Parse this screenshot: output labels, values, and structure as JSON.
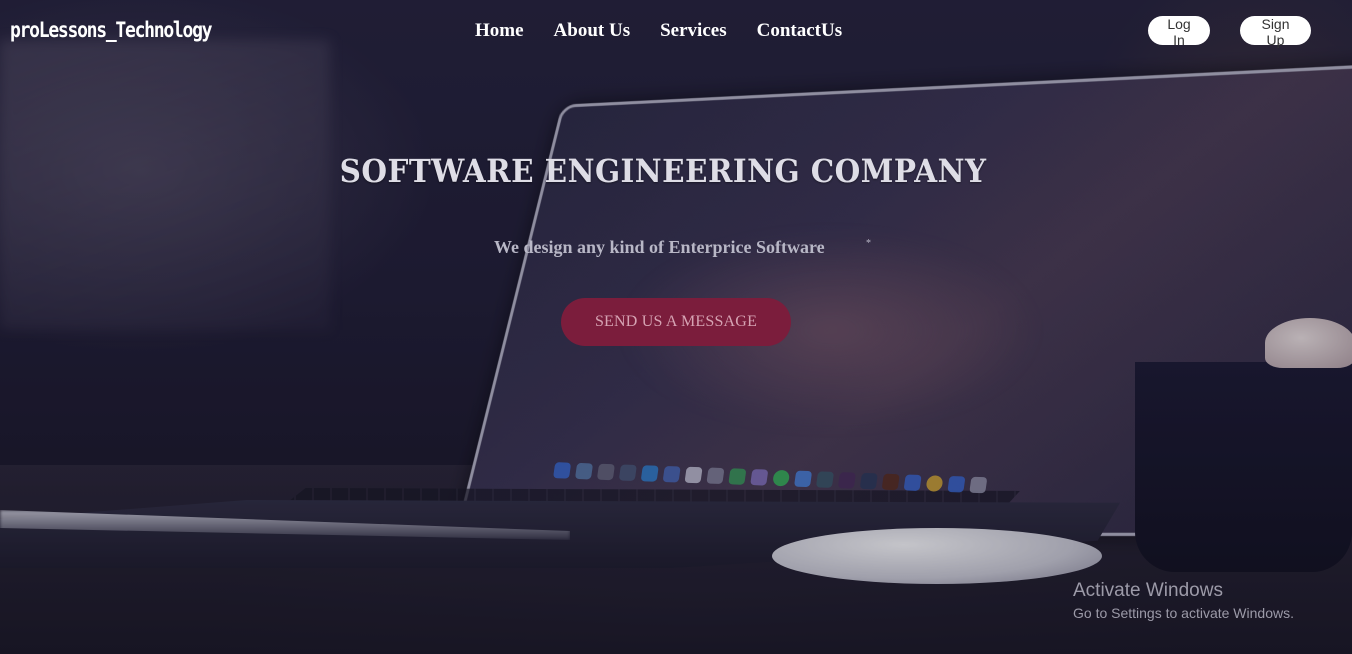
{
  "header": {
    "brand": "proLessons_Technology",
    "nav": [
      {
        "label": "Home"
      },
      {
        "label": "About Us"
      },
      {
        "label": "Services"
      },
      {
        "label": "ContactUs"
      }
    ],
    "login_label": "Log In",
    "signup_label": "Sign Up"
  },
  "hero": {
    "title": "SOFTWARE ENGINEERING COMPANY",
    "subtitle": "We design any kind of Enterprice Software",
    "subtitle_mark": "*",
    "cta_label": "SEND US A MESSAGE"
  },
  "watermark": {
    "title": "Activate Windows",
    "subtitle": "Go to Settings to activate Windows."
  },
  "colors": {
    "cta_background": "#7b1d3c",
    "cta_text": "#d6a3b3",
    "nav_text": "#ffffff",
    "button_background": "#ffffff"
  },
  "background_image": "laptop-on-desk-photo"
}
